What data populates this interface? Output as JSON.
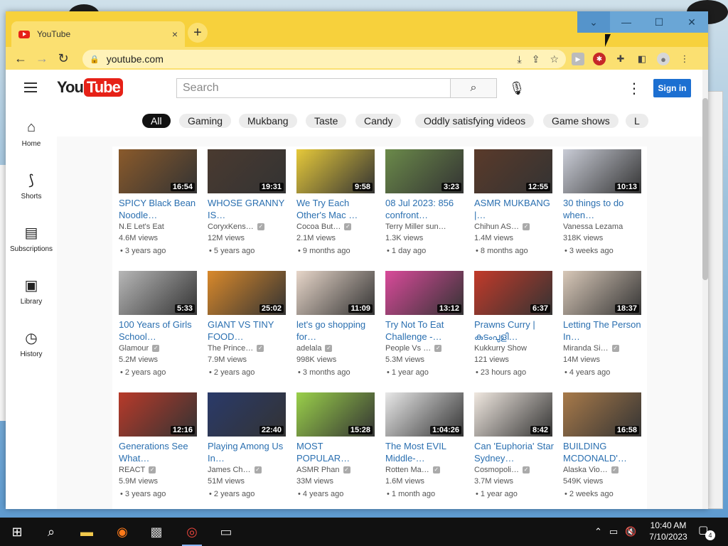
{
  "browser": {
    "tab_title": "YouTube",
    "tab_close": "×",
    "new_tab": "+",
    "url": "youtube.com",
    "window_controls": {
      "dropdown": "⌄",
      "minimize": "—",
      "maximize": "☐",
      "close": "✕"
    }
  },
  "youtube": {
    "logo_you": "You",
    "logo_tube": "Tube",
    "search_placeholder": "Search",
    "signin_label": "Sign in",
    "sidebar": [
      {
        "label": "Home",
        "icon": "home-icon"
      },
      {
        "label": "Shorts",
        "icon": "shorts-icon"
      },
      {
        "label": "Subscriptions",
        "icon": "subscriptions-icon"
      },
      {
        "label": "Library",
        "icon": "library-icon"
      },
      {
        "label": "History",
        "icon": "history-icon"
      }
    ],
    "chips": [
      "All",
      "Gaming",
      "Mukbang",
      "Taste",
      "Candy",
      "Oddly satisfying videos",
      "Game shows",
      "L"
    ],
    "videos": [
      {
        "title": "SPICY Black Bean Noodle…",
        "channel": "N.E Let's Eat",
        "verified": false,
        "views": "4.6M views",
        "age": "3 years ago",
        "duration": "16:54"
      },
      {
        "title": "WHOSE GRANNY IS…",
        "channel": "CoryxKens…",
        "verified": true,
        "views": "12M views",
        "age": "5 years ago",
        "duration": "19:31"
      },
      {
        "title": "We Try Each Other's Mac …",
        "channel": "Cocoa But…",
        "verified": true,
        "views": "2.1M views",
        "age": "9 months ago",
        "duration": "9:58"
      },
      {
        "title": "08 Jul 2023: 856 confront…",
        "channel": "Terry Miller sun…",
        "verified": false,
        "views": "1.3K views",
        "age": "1 day ago",
        "duration": "3:23"
      },
      {
        "title": "ASMR MUKBANG |…",
        "channel": "Chihun AS…",
        "verified": true,
        "views": "1.4M views",
        "age": "8 months ago",
        "duration": "12:55"
      },
      {
        "title": "30 things to do when…",
        "channel": "Vanessa Lezama",
        "verified": false,
        "views": "318K views",
        "age": "3 weeks ago",
        "duration": "10:13"
      },
      {
        "title": "100 Years of Girls School…",
        "channel": "Glamour",
        "verified": true,
        "views": "5.2M views",
        "age": "2 years ago",
        "duration": "5:33"
      },
      {
        "title": "GIANT VS TINY FOOD…",
        "channel": "The Prince…",
        "verified": true,
        "views": "7.9M views",
        "age": "2 years ago",
        "duration": "25:02"
      },
      {
        "title": "let's go shopping for…",
        "channel": "adelala",
        "verified": true,
        "views": "998K views",
        "age": "3 months ago",
        "duration": "11:09"
      },
      {
        "title": "Try Not To Eat Challenge -…",
        "channel": "People Vs …",
        "verified": true,
        "views": "5.3M views",
        "age": "1 year ago",
        "duration": "13:12"
      },
      {
        "title": "Prawns Curry | കുടംപുളി…",
        "channel": "Kukkurry Show",
        "verified": false,
        "views": "121 views",
        "age": "23 hours ago",
        "duration": "6:37"
      },
      {
        "title": "Letting The Person In…",
        "channel": "Miranda Si…",
        "verified": true,
        "views": "14M views",
        "age": "4 years ago",
        "duration": "18:37"
      },
      {
        "title": "Generations See What…",
        "channel": "REACT",
        "verified": true,
        "views": "5.9M views",
        "age": "3 years ago",
        "duration": "12:16"
      },
      {
        "title": "Playing Among Us In…",
        "channel": "James Ch…",
        "verified": true,
        "views": "51M views",
        "age": "2 years ago",
        "duration": "22:40"
      },
      {
        "title": "MOST POPULAR…",
        "channel": "ASMR Phan",
        "verified": true,
        "views": "33M views",
        "age": "4 years ago",
        "duration": "15:28"
      },
      {
        "title": "The Most EVIL Middle-…",
        "channel": "Rotten Ma…",
        "verified": true,
        "views": "1.6M views",
        "age": "1 month ago",
        "duration": "1:04:26"
      },
      {
        "title": "Can 'Euphoria' Star Sydney…",
        "channel": "Cosmopoli…",
        "verified": true,
        "views": "3.7M views",
        "age": "1 year ago",
        "duration": "8:42"
      },
      {
        "title": "BUILDING MCDONALD'…",
        "channel": "Alaska Vio…",
        "verified": true,
        "views": "549K views",
        "age": "2 weeks ago",
        "duration": "16:58"
      }
    ],
    "thumb_colors": [
      "#8a5a2b",
      "#4a3a30",
      "#e6c93a",
      "#6b8a4a",
      "#5a3a2a",
      "#c9ccd6",
      "#b7b7b7",
      "#d9892b",
      "#e7d6c9",
      "#d94a9a",
      "#c23a2a",
      "#d8c8b8",
      "#b83a2a",
      "#2a3a6a",
      "#9ad04a",
      "#e8e8e8",
      "#f0e8e0",
      "#a87a4a"
    ]
  },
  "taskbar": {
    "time": "10:40 AM",
    "date": "7/10/2023",
    "notifications": "4"
  }
}
